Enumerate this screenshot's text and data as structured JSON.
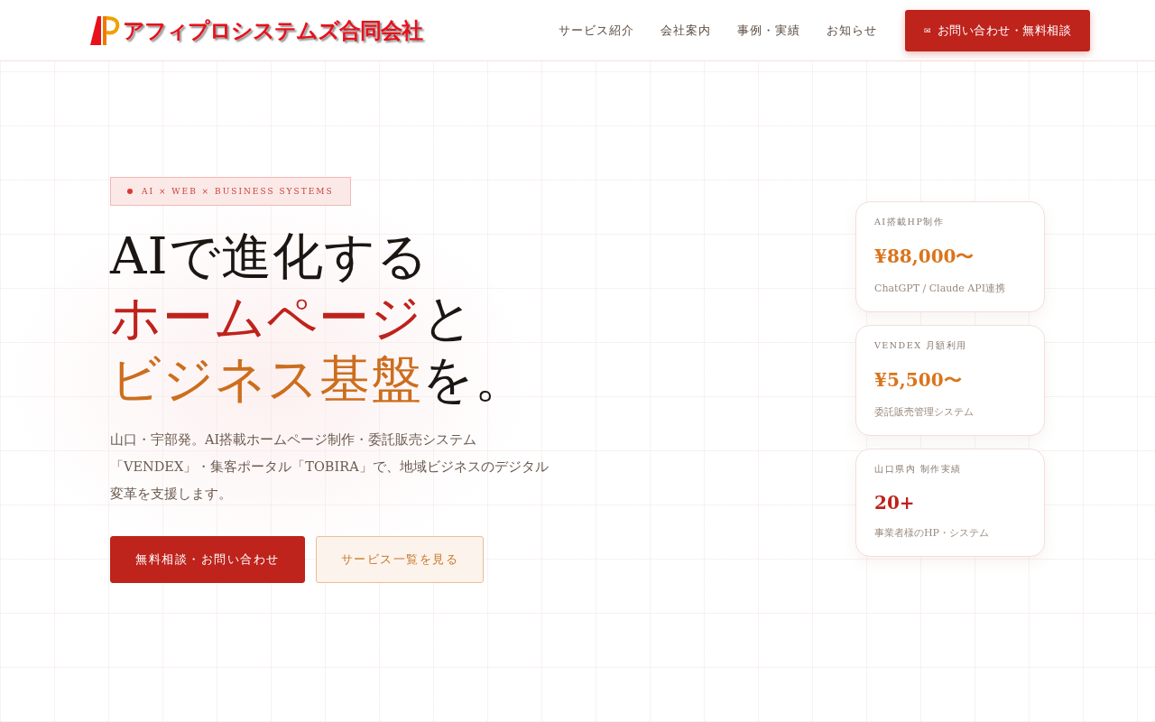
{
  "header": {
    "logo": "アフィプロシステムズ合同会社",
    "nav": [
      {
        "label": "サービス紹介"
      },
      {
        "label": "会社案内"
      },
      {
        "label": "事例・実績"
      },
      {
        "label": "お知らせ"
      }
    ],
    "cta": {
      "icon": "✉",
      "label": "お問い合わせ・無料相談"
    }
  },
  "hero": {
    "badge": "AI × WEB × BUSINESS SYSTEMS",
    "headline": [
      [
        {
          "text": "AIで進化する",
          "color": "#1c1612"
        }
      ],
      [
        {
          "text": "ホームページ",
          "color": "#be231c"
        },
        {
          "text": "と",
          "color": "#1c1612"
        }
      ],
      [
        {
          "text": "ビジネス基盤",
          "color": "#cc6e1e"
        },
        {
          "text": "を。",
          "color": "#1c1612"
        }
      ]
    ],
    "lead": "山口・宇部発。AI搭載ホームページ制作・委託販売システム「VENDEX」・集客ポータル「TOBIRA」で、地域ビジネスのデジタル変革を支援します。",
    "buttons": [
      {
        "label": "無料相談・お問い合わせ",
        "kind": "primary"
      },
      {
        "label": "サービス一覧を見る",
        "kind": "secondary"
      }
    ]
  },
  "stats": [
    {
      "label": "AI搭載HP制作",
      "value": "¥88,000〜",
      "color": "#d9741c",
      "note": "ChatGPT / Claude API連携"
    },
    {
      "label": "VENDEX 月額利用",
      "value": "¥5,500〜",
      "color": "#d9741c",
      "note": "委託販売管理システム"
    },
    {
      "label": "山口県内 制作実績",
      "value": "20+",
      "color": "#be231c",
      "note": "事業者様のHP・システム"
    }
  ]
}
